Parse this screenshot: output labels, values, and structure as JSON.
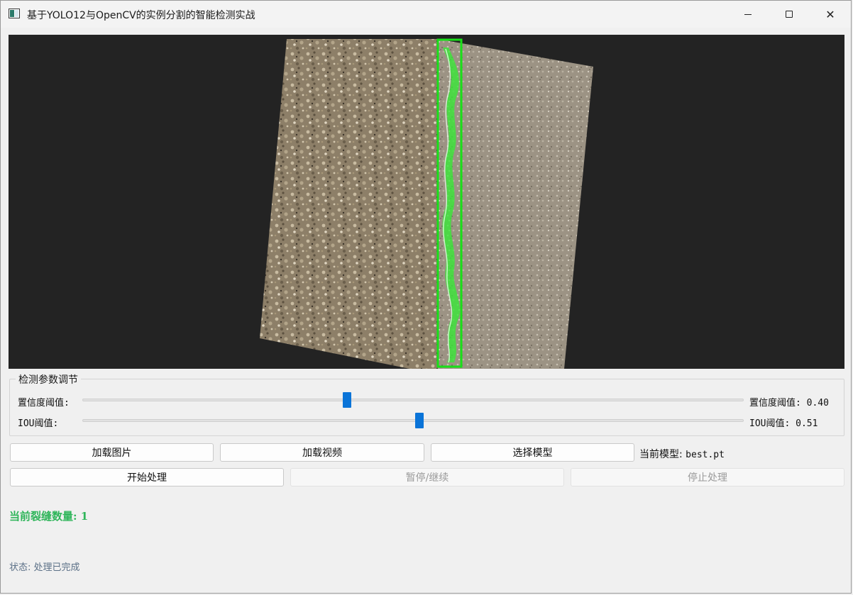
{
  "window": {
    "title": "基于YOLO12与OpenCV的实例分割的智能检测实战"
  },
  "viewer": {
    "detections": [
      {
        "label": "crack",
        "box_color": "#19e019",
        "mask_color": "#33ee33"
      }
    ]
  },
  "params": {
    "group_title": "检测参数调节",
    "confidence": {
      "label": "置信度阈值:",
      "value_text": "置信度阈值: 0.40",
      "value": 0.4
    },
    "iou": {
      "label": "IOU阈值:",
      "value_text": "IOU阈值: 0.51",
      "value": 0.51
    }
  },
  "toolbar": {
    "load_image": "加载图片",
    "load_video": "加载视频",
    "select_model": "选择模型",
    "current_model_label": "当前模型:",
    "current_model_value": "best.pt",
    "start": "开始处理",
    "pause": "暂停/继续",
    "stop": "停止处理"
  },
  "results": {
    "crack_count_text": "当前裂缝数量: 1"
  },
  "status": {
    "text": "状态: 处理已完成"
  },
  "colors": {
    "accent": "#0a74d8",
    "count_green": "#2fb55a",
    "status_text": "#5a6f86"
  }
}
